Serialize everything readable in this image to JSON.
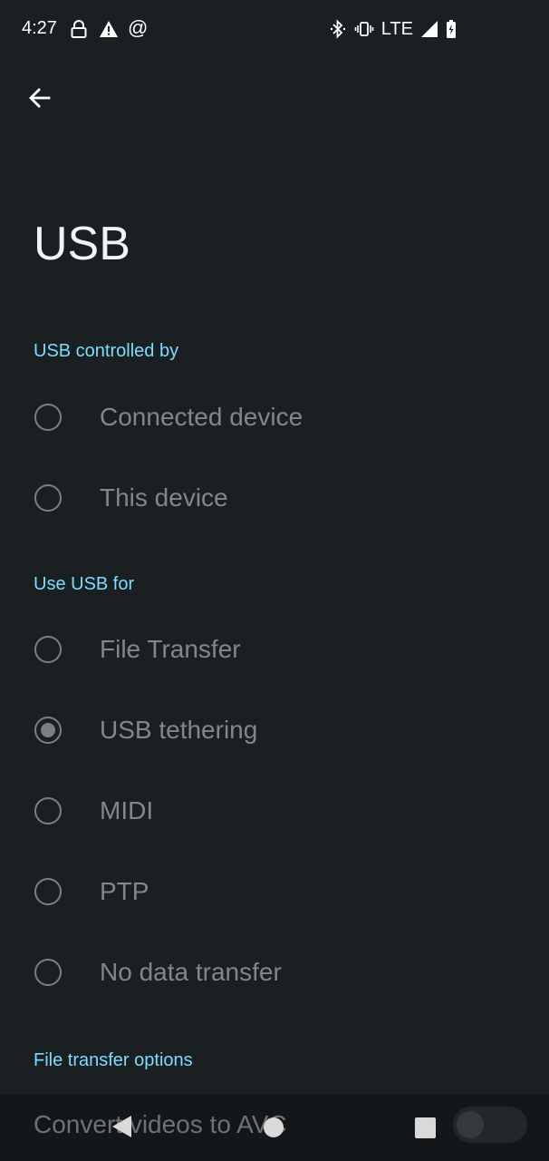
{
  "status_bar": {
    "time": "4:27",
    "network": "LTE",
    "icons": [
      "lock-icon",
      "warning-icon",
      "at-icon",
      "bluetooth-icon",
      "vibrate-icon",
      "signal-icon",
      "battery-charging-icon"
    ]
  },
  "header": {
    "back_icon": "arrow-left-icon",
    "title": "USB"
  },
  "sections": {
    "controlled_by": "USB controlled by",
    "use_for": "Use USB for",
    "file_transfer_options": "File transfer options"
  },
  "controlled_options": [
    {
      "label": "Connected device",
      "selected": false
    },
    {
      "label": "This device",
      "selected": false
    }
  ],
  "use_options": [
    {
      "label": "File Transfer",
      "selected": false
    },
    {
      "label": "USB tethering",
      "selected": true
    },
    {
      "label": "MIDI",
      "selected": false
    },
    {
      "label": "PTP",
      "selected": false
    },
    {
      "label": "No data transfer",
      "selected": false
    }
  ],
  "file_transfer": {
    "convert_label": "Convert videos to AVC",
    "convert_enabled": false
  },
  "colors": {
    "background": "#1a1f21",
    "accent": "#7fdbff",
    "disabled_text": "#82878a"
  }
}
